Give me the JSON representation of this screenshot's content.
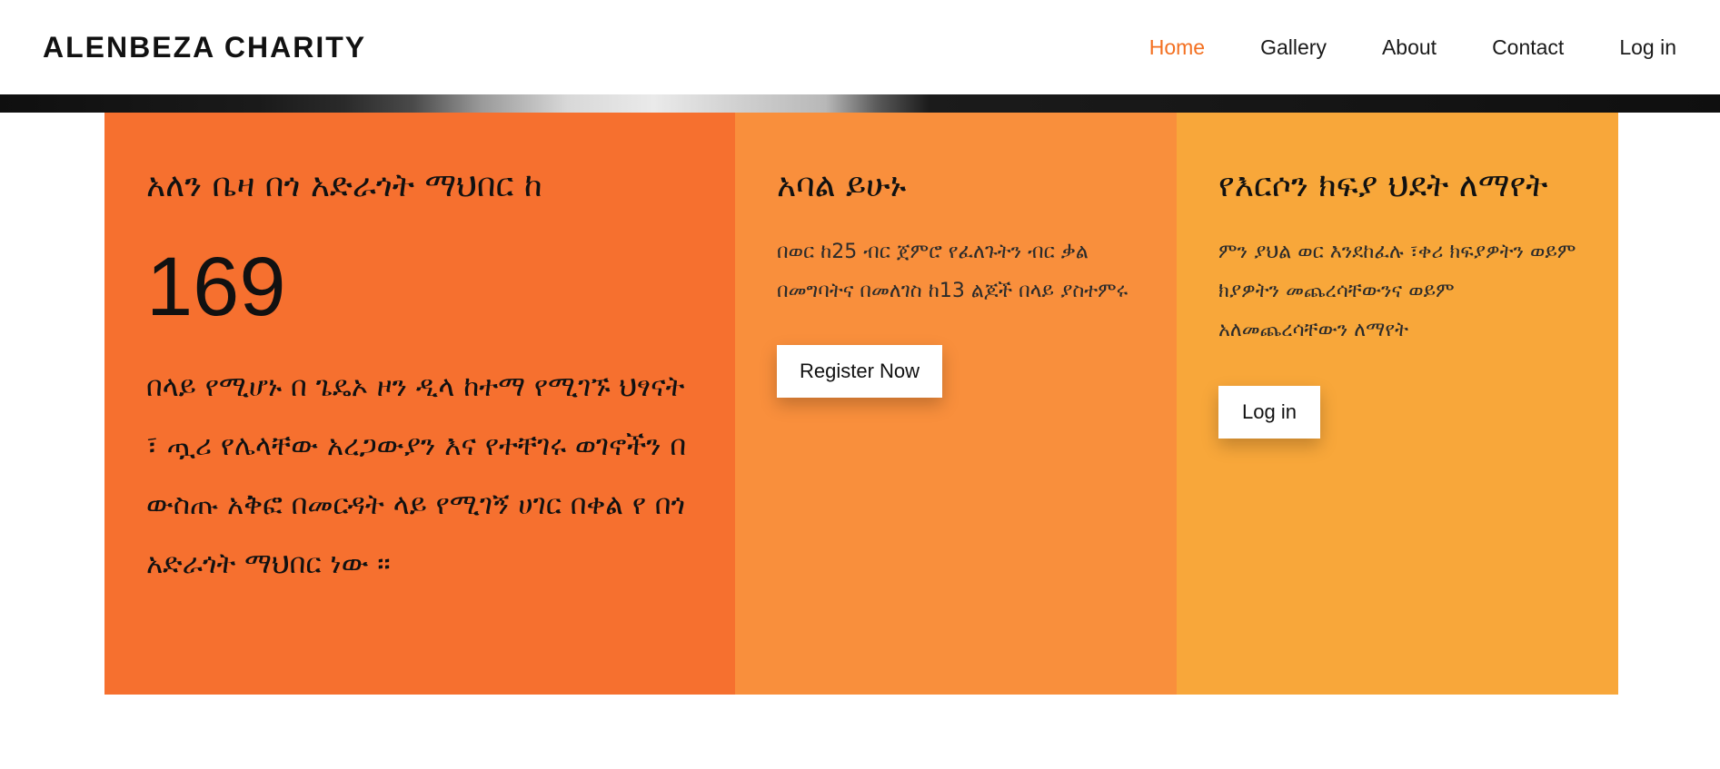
{
  "navbar": {
    "brand": "ALENBEZA CHARITY",
    "links": [
      {
        "label": "Home",
        "active": true
      },
      {
        "label": "Gallery",
        "active": false
      },
      {
        "label": "About",
        "active": false
      },
      {
        "label": "Contact",
        "active": false
      },
      {
        "label": "Log in",
        "active": false
      }
    ]
  },
  "panels": {
    "stats": {
      "heading": "አለን ቤዛ በጎ አድራጎት ማህበር ከ",
      "number": "169",
      "text": "በላይ የሚሆኑ በ ጌዴኦ ዞን ዲላ ከተማ የሚገኙ ህፃናት ፣ ጧሪ የሌላቸው አረጋውያን እና የተቸገሩ ወገኖችን በ ውስጡ አቅፎ በመርዳት ላይ የሚገኝ ሀገር በቀል የ በጎ አድራጎት ማህበር ነው ።"
    },
    "member": {
      "heading": "አባል ይሁኑ",
      "text": "በወር ከ25 ብር ጀምሮ የፈለጉትን ብር ቃል በመግባትና በመለገስ ከ13 ልጆች በላይ ያስተምሩ",
      "button": "Register Now"
    },
    "payment": {
      "heading": "የእርሶን ክፍያ ህደት ለማየት",
      "text": "ምን ያህል ወር እንደከፈሉ ፣ቀሪ ክፍያዎትን ወይም ክያዎትን መጨረሳቸውንና ወይም አለመጨረሳቸውን ለማየት",
      "button": "Log in"
    }
  },
  "colors": {
    "accent": "#f37021",
    "panel_1": "#f6702f",
    "panel_2": "#f98f3c",
    "panel_3": "#f8a73a"
  }
}
